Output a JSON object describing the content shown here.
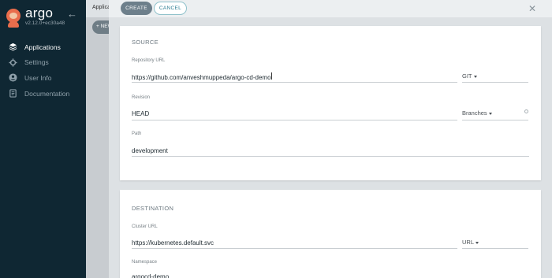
{
  "sidebar": {
    "brand_name": "argo",
    "version": "v2.12.0+ec30a48",
    "items": [
      {
        "label": "Applications",
        "icon": "layers-icon",
        "active": true
      },
      {
        "label": "Settings",
        "icon": "gear-icon",
        "active": false
      },
      {
        "label": "User Info",
        "icon": "user-icon",
        "active": false
      },
      {
        "label": "Documentation",
        "icon": "book-icon",
        "active": false
      }
    ]
  },
  "background": {
    "breadcrumb": "Applications",
    "new_app_button": "+ NEW APP"
  },
  "panel": {
    "create_label": "CREATE",
    "cancel_label": "CANCEL",
    "source": {
      "title": "SOURCE",
      "repo_url": {
        "label": "Repository URL",
        "value": "https://github.com/anveshmuppeda/argo-cd-demo"
      },
      "repo_type": "GIT",
      "revision": {
        "label": "Revision",
        "value": "HEAD"
      },
      "revision_type": "Branches",
      "path": {
        "label": "Path",
        "value": "development"
      }
    },
    "destination": {
      "title": "DESTINATION",
      "cluster_url": {
        "label": "Cluster URL",
        "value": "https://kubernetes.default.svc"
      },
      "cluster_type": "URL",
      "namespace": {
        "label": "Namespace",
        "value": "argocd-demo"
      }
    }
  },
  "colors": {
    "sidebar_bg": "#0f2733",
    "create_button": "#6d7f8b",
    "cancel_text": "#2d7e93",
    "brand_logo": "#e96d4c"
  }
}
